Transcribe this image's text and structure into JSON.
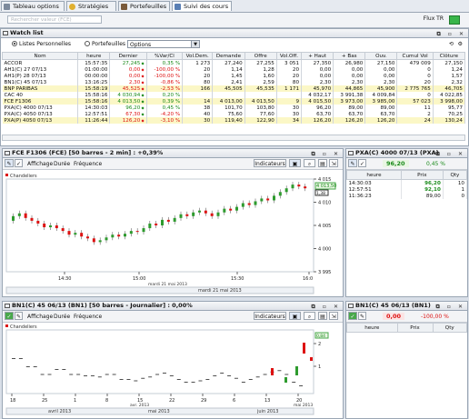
{
  "tabs": [
    {
      "label": "Tableau options",
      "active": false
    },
    {
      "label": "Stratégies",
      "active": false
    },
    {
      "label": "Portefeuilles",
      "active": false
    },
    {
      "label": "Suivi des cours",
      "active": true
    }
  ],
  "toolbar": {
    "search_placeholder": "Rechercher valeur (FCE)",
    "flux_label": "Flux TR"
  },
  "watchlist": {
    "title": "Watch list",
    "radio_listes": "Listes Personnelles",
    "radio_portefeuilles": "Portefeuilles",
    "dropdown_value": "Options",
    "columns": [
      "Nom",
      "heure",
      "Dernier",
      "%Var/Cl",
      "Vol.Dem.",
      "Demande",
      "Offre",
      "Vol.Off.",
      "+ Haut",
      "+ Bas",
      "Ouv.",
      "Cumul Vol",
      "Clôture"
    ],
    "rows": [
      {
        "name": "ACCOR",
        "heure": "15:57:35",
        "dernier": "27,245",
        "dir": "up",
        "var": "0,35 %",
        "vdem": "1 273",
        "dem": "27,240",
        "off": "27,255",
        "voff": "3 051",
        "haut": "27,350",
        "bas": "26,980",
        "ouv": "27,150",
        "cumul": "479 009",
        "clot": "27,150",
        "tone": "pos"
      },
      {
        "name": "AH1(C) 27 07/13",
        "heure": "01:00:00",
        "dernier": "0,00",
        "dir": "down",
        "var": "-100,00 %",
        "vdem": "20",
        "dem": "1,14",
        "off": "1,28",
        "voff": "20",
        "haut": "0,00",
        "bas": "0,00",
        "ouv": "0,00",
        "cumul": "0",
        "clot": "1,24",
        "tone": "neg"
      },
      {
        "name": "AH1(P) 28 07/13",
        "heure": "00:00:00",
        "dernier": "0,00",
        "dir": "down",
        "var": "-100,00 %",
        "vdem": "20",
        "dem": "1,45",
        "off": "1,60",
        "voff": "20",
        "haut": "0,00",
        "bas": "0,00",
        "ouv": "0,00",
        "cumul": "0",
        "clot": "1,57",
        "tone": "neg"
      },
      {
        "name": "BN1(C) 45 07/13",
        "heure": "13:16:25",
        "dernier": "2,30",
        "dir": "down",
        "var": "-0,86 %",
        "vdem": "80",
        "dem": "2,41",
        "off": "2,59",
        "voff": "80",
        "haut": "2,30",
        "bas": "2,30",
        "ouv": "2,30",
        "cumul": "20",
        "clot": "2,32",
        "tone": "neg"
      },
      {
        "name": "BNP PARIBAS",
        "heure": "15:58:19",
        "dernier": "45,525",
        "dir": "down",
        "var": "-2,53 %",
        "vdem": "166",
        "dem": "45,505",
        "off": "45,535",
        "voff": "1 171",
        "haut": "45,970",
        "bas": "44,865",
        "ouv": "45,900",
        "cumul": "2 775 765",
        "clot": "46,705",
        "tone": "neg"
      },
      {
        "name": "CAC 40",
        "heure": "15:58:16",
        "dernier": "4 030,94",
        "dir": "up",
        "var": "0,20 %",
        "vdem": "",
        "dem": "",
        "off": "",
        "voff": "",
        "haut": "4 032,17",
        "bas": "3 991,38",
        "ouv": "4 009,84",
        "cumul": "0",
        "clot": "4 022,85",
        "tone": "pos"
      },
      {
        "name": "FCE F1306",
        "heure": "15:58:16",
        "dernier": "4 013,50",
        "dir": "up",
        "var": "0,39 %",
        "vdem": "14",
        "dem": "4 013,00",
        "off": "4 013,50",
        "voff": "9",
        "haut": "4 015,50",
        "bas": "3 973,00",
        "ouv": "3 985,00",
        "cumul": "57 023",
        "clot": "3 998,00",
        "tone": "pos"
      },
      {
        "name": "PXA(C) 4000 07/13",
        "heure": "14:30:03",
        "dernier": "96,20",
        "dir": "up",
        "var": "0,45 %",
        "vdem": "38",
        "dem": "101,70",
        "off": "103,80",
        "voff": "30",
        "haut": "96,20",
        "bas": "89,00",
        "ouv": "89,00",
        "cumul": "11",
        "clot": "95,77",
        "tone": "pos"
      },
      {
        "name": "PXA(C) 4050 07/13",
        "heure": "12:57:51",
        "dernier": "67,30",
        "dir": "up",
        "var": "-4,20 %",
        "vdem": "40",
        "dem": "75,60",
        "off": "77,60",
        "voff": "30",
        "haut": "63,70",
        "bas": "63,70",
        "ouv": "63,70",
        "cumul": "2",
        "clot": "70,25",
        "tone": "neg"
      },
      {
        "name": "PXA(P) 4050 07/13",
        "heure": "11:26:44",
        "dernier": "126,20",
        "dir": "down",
        "var": "-3,10 %",
        "vdem": "30",
        "dem": "119,40",
        "off": "122,90",
        "voff": "34",
        "haut": "126,20",
        "bas": "126,20",
        "ouv": "126,20",
        "cumul": "24",
        "clot": "130,24",
        "tone": "neg"
      }
    ]
  },
  "chart1": {
    "title": "FCE F1306 (FCE) [50 barres - 2 min] : +0,39%",
    "menu": [
      "Affichage",
      "Durée",
      "Fréquence"
    ],
    "indicators_label": "Indicateurs",
    "legend": "Chandeliers",
    "last_price": "4 013,50",
    "cursor_price": "4 011",
    "small_box": "1,38",
    "y_ticks": [
      "4 015",
      "4 010",
      "4 005",
      "4 000",
      "3 995"
    ],
    "x_ticks": [
      "14:30",
      "15:00",
      "15:30",
      "16:0"
    ],
    "x_subtitle": "mardi 21 mai 2013",
    "x_date_bar": "mardi 21 mai 2013"
  },
  "chart2": {
    "title": "BN1(C) 45 06/13 (BN1) [50 barres - Journalier] : 0,00%",
    "menu": [
      "Affichage",
      "Durée",
      "Fréquence"
    ],
    "indicators_label": "Indicateurs",
    "legend": "Chandeliers",
    "cursor_price": "2",
    "small_box": "0,84",
    "y_ticks": [
      "2",
      "1"
    ],
    "x_ticks": [
      "18",
      "25",
      "1",
      "8",
      "15",
      "22",
      "29",
      "6",
      "13",
      "20"
    ],
    "x_subtitle_1": "avr. 2013",
    "x_subtitle_2": "mai 2013",
    "x_months": [
      "avril 2013",
      "mai 2013",
      "juin 2013"
    ]
  },
  "quote1": {
    "title": "PXA(C) 4000 07/13 (PXA)",
    "last": "96,20",
    "change": "0,45 %",
    "columns": [
      "heure",
      "Prix",
      "Qty"
    ],
    "rows": [
      [
        "14:30:03",
        "96,20",
        "10"
      ],
      [
        "12:57:51",
        "92,10",
        "1"
      ],
      [
        "11:36:23",
        "89,00",
        "0"
      ]
    ]
  },
  "quote2": {
    "title": "BN1(C) 45 06/13 (BN1)",
    "last": "0,00",
    "change": "-100,00 %",
    "columns": [
      "heure",
      "Prix",
      "Qty"
    ]
  }
}
